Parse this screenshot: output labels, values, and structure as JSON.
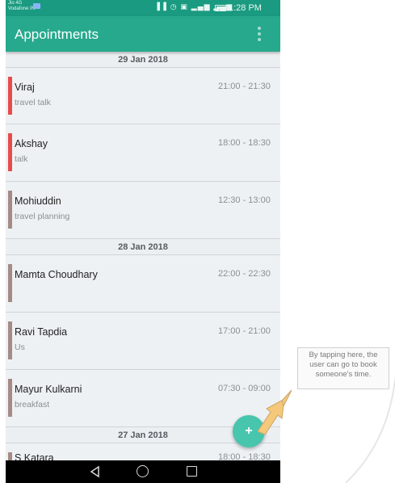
{
  "status_bar": {
    "carrier_line1": "Jio 4G",
    "carrier_line2": "Vodafone IN",
    "signal_icons": "▐▐ ◷ ▣ ▂▄▆ ▂▄▆",
    "time": "1:28 PM"
  },
  "app_bar": {
    "title": "Appointments",
    "overflow_icon": "vertical-ellipsis-icon"
  },
  "sections": [
    {
      "date": "29 Jan 2018",
      "items": [
        {
          "name": "Viraj",
          "topic": "travel talk",
          "time": "21:00 - 21:30",
          "color": "#e84b4b"
        },
        {
          "name": "Akshay",
          "topic": "talk",
          "time": "18:00 - 18:30",
          "color": "#e84b4b"
        },
        {
          "name": "Mohiuddin",
          "topic": "travel planning",
          "time": "12:30 - 13:00",
          "color": "#a48b86"
        }
      ]
    },
    {
      "date": "28 Jan 2018",
      "items": [
        {
          "name": "Mamta Choudhary",
          "topic": "",
          "time": "22:00 - 22:30",
          "color": "#a48b86"
        },
        {
          "name": "Ravi Tapdia",
          "topic": "Us",
          "time": "17:00 - 21:00",
          "color": "#a48b86"
        },
        {
          "name": "Mayur Kulkarni",
          "topic": "breakfast",
          "time": "07:30 - 09:00",
          "color": "#a48b86"
        }
      ]
    },
    {
      "date": "27 Jan 2018",
      "items": [
        {
          "name": "S Katara",
          "topic": "",
          "time": "18:00 - 18:30",
          "color": "#a48b86"
        }
      ]
    }
  ],
  "fab": {
    "label": "+"
  },
  "tooltip": {
    "text": "By tapping here, the user can go to book someone's time."
  },
  "colors": {
    "app_bar": "#26a98d",
    "status_bar": "#1a9a80",
    "fab": "#48c6ad",
    "accent_red": "#e84b4b",
    "accent_brown": "#a48b86",
    "arrow": "#f5c87a"
  }
}
